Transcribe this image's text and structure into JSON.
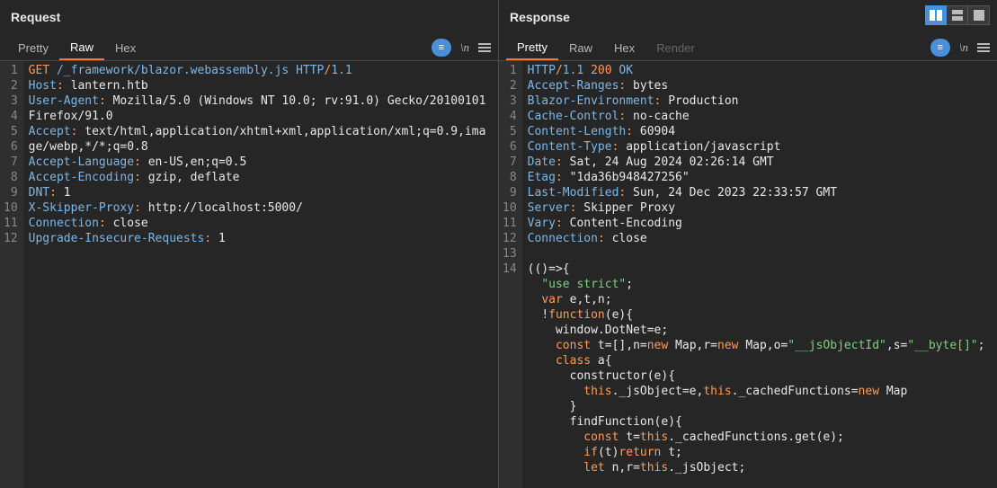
{
  "request": {
    "title": "Request",
    "tabs": {
      "pretty": "Pretty",
      "raw": "Raw",
      "hex": "Hex"
    },
    "lines": [
      {
        "n": "1",
        "seg": [
          [
            "m",
            "GET"
          ],
          [
            "w",
            " "
          ],
          [
            "hk",
            "/_framework/blazor.webassembly.js"
          ],
          [
            "w",
            " "
          ],
          [
            "hk",
            "HTTP"
          ],
          [
            "m",
            "/"
          ],
          [
            "hk",
            "1.1"
          ]
        ]
      },
      {
        "n": "2",
        "seg": [
          [
            "hk",
            "Host"
          ],
          [
            "m",
            ":"
          ],
          [
            "w",
            " lantern.htb"
          ]
        ]
      },
      {
        "n": "3",
        "seg": [
          [
            "hk",
            "User-Agent"
          ],
          [
            "m",
            ":"
          ],
          [
            "w",
            " Mozilla/5.0 (Windows NT 10.0; rv:91.0) Gecko/20100101 Firefox/91.0"
          ]
        ]
      },
      {
        "n": "4",
        "seg": [
          [
            "hk",
            "Accept"
          ],
          [
            "m",
            ":"
          ],
          [
            "w",
            " text/html,application/xhtml+xml,application/xml;q=0.9,image/webp,*/*;q=0.8"
          ]
        ]
      },
      {
        "n": "5",
        "seg": [
          [
            "hk",
            "Accept-Language"
          ],
          [
            "m",
            ":"
          ],
          [
            "w",
            " en-US,en;q=0.5"
          ]
        ]
      },
      {
        "n": "6",
        "seg": [
          [
            "hk",
            "Accept-Encoding"
          ],
          [
            "m",
            ":"
          ],
          [
            "w",
            " gzip, deflate"
          ]
        ]
      },
      {
        "n": "7",
        "seg": [
          [
            "hk",
            "DNT"
          ],
          [
            "m",
            ":"
          ],
          [
            "w",
            " 1"
          ]
        ]
      },
      {
        "n": "8",
        "seg": [
          [
            "hk",
            "X-Skipper-Proxy"
          ],
          [
            "m",
            ":"
          ],
          [
            "w",
            " http://localhost:5000/"
          ]
        ]
      },
      {
        "n": "9",
        "seg": [
          [
            "hk",
            "Connection"
          ],
          [
            "m",
            ":"
          ],
          [
            "w",
            " close"
          ]
        ]
      },
      {
        "n": "10",
        "seg": [
          [
            "hk",
            "Upgrade-Insecure-Requests"
          ],
          [
            "m",
            ":"
          ],
          [
            "w",
            " 1"
          ]
        ]
      },
      {
        "n": "11",
        "seg": []
      },
      {
        "n": "12",
        "seg": []
      }
    ]
  },
  "response": {
    "title": "Response",
    "tabs": {
      "pretty": "Pretty",
      "raw": "Raw",
      "hex": "Hex",
      "render": "Render"
    },
    "lines": [
      {
        "n": "1",
        "seg": [
          [
            "hk",
            "HTTP"
          ],
          [
            "m",
            "/"
          ],
          [
            "hk",
            "1.1 "
          ],
          [
            "m",
            "200 "
          ],
          [
            "hk",
            "OK"
          ]
        ]
      },
      {
        "n": "2",
        "seg": [
          [
            "hk",
            "Accept-Ranges"
          ],
          [
            "m",
            ":"
          ],
          [
            "w",
            " bytes"
          ]
        ]
      },
      {
        "n": "3",
        "seg": [
          [
            "hk",
            "Blazor-Environment"
          ],
          [
            "m",
            ":"
          ],
          [
            "w",
            " Production"
          ]
        ]
      },
      {
        "n": "4",
        "seg": [
          [
            "hk",
            "Cache-Control"
          ],
          [
            "m",
            ":"
          ],
          [
            "w",
            " no-cache"
          ]
        ]
      },
      {
        "n": "5",
        "seg": [
          [
            "hk",
            "Content-Length"
          ],
          [
            "m",
            ":"
          ],
          [
            "w",
            " 60904"
          ]
        ]
      },
      {
        "n": "6",
        "seg": [
          [
            "hk",
            "Content-Type"
          ],
          [
            "m",
            ":"
          ],
          [
            "w",
            " application/javascript"
          ]
        ]
      },
      {
        "n": "7",
        "seg": [
          [
            "hk",
            "Date"
          ],
          [
            "m",
            ":"
          ],
          [
            "w",
            " Sat, 24 Aug 2024 02:26:14 GMT"
          ]
        ]
      },
      {
        "n": "8",
        "seg": [
          [
            "hk",
            "Etag"
          ],
          [
            "m",
            ":"
          ],
          [
            "w",
            " \"1da36b948427256\""
          ]
        ]
      },
      {
        "n": "9",
        "seg": [
          [
            "hk",
            "Last-Modified"
          ],
          [
            "m",
            ":"
          ],
          [
            "w",
            " Sun, 24 Dec 2023 22:33:57 GMT"
          ]
        ]
      },
      {
        "n": "10",
        "seg": [
          [
            "hk",
            "Server"
          ],
          [
            "m",
            ":"
          ],
          [
            "w",
            " Skipper Proxy"
          ]
        ]
      },
      {
        "n": "11",
        "seg": [
          [
            "hk",
            "Vary"
          ],
          [
            "m",
            ":"
          ],
          [
            "w",
            " Content-Encoding"
          ]
        ]
      },
      {
        "n": "12",
        "seg": [
          [
            "hk",
            "Connection"
          ],
          [
            "m",
            ":"
          ],
          [
            "w",
            " close"
          ]
        ]
      },
      {
        "n": "13",
        "seg": []
      },
      {
        "n": "14",
        "seg": [
          [
            "w",
            "(()=>{"
          ]
        ]
      },
      {
        "n": "",
        "seg": [
          [
            "w",
            "  "
          ],
          [
            "s",
            "\"use strict\""
          ],
          [
            "w",
            ";"
          ]
        ]
      },
      {
        "n": "",
        "seg": [
          [
            "w",
            "  "
          ],
          [
            "kw",
            "var"
          ],
          [
            "w",
            " e,t,n;"
          ]
        ]
      },
      {
        "n": "",
        "seg": [
          [
            "w",
            "  !"
          ],
          [
            "kw",
            "function"
          ],
          [
            "w",
            "(e){"
          ]
        ]
      },
      {
        "n": "",
        "seg": [
          [
            "w",
            "    window.DotNet=e;"
          ]
        ]
      },
      {
        "n": "",
        "seg": [
          [
            "w",
            "    "
          ],
          [
            "kw",
            "const"
          ],
          [
            "w",
            " t=[],n="
          ],
          [
            "kw",
            "new"
          ],
          [
            "w",
            " Map,r="
          ],
          [
            "kw",
            "new"
          ],
          [
            "w",
            " Map,o="
          ],
          [
            "s",
            "\"__jsObjectId\""
          ],
          [
            "w",
            ",s="
          ],
          [
            "s",
            "\"__byte[]\""
          ],
          [
            "w",
            ";"
          ]
        ]
      },
      {
        "n": "",
        "seg": [
          [
            "w",
            "    "
          ],
          [
            "kw",
            "class"
          ],
          [
            "w",
            " a{"
          ]
        ]
      },
      {
        "n": "",
        "seg": [
          [
            "w",
            "      constructor(e){"
          ]
        ]
      },
      {
        "n": "",
        "seg": [
          [
            "w",
            "        "
          ],
          [
            "kw",
            "this"
          ],
          [
            "w",
            "._jsObject=e,"
          ],
          [
            "kw",
            "this"
          ],
          [
            "w",
            "._cachedFunctions="
          ],
          [
            "kw",
            "new"
          ],
          [
            "w",
            " Map"
          ]
        ]
      },
      {
        "n": "",
        "seg": [
          [
            "w",
            "      }"
          ]
        ]
      },
      {
        "n": "",
        "seg": [
          [
            "w",
            "      findFunction(e){"
          ]
        ]
      },
      {
        "n": "",
        "seg": [
          [
            "w",
            "        "
          ],
          [
            "kw",
            "const"
          ],
          [
            "w",
            " t="
          ],
          [
            "kw",
            "this"
          ],
          [
            "w",
            "._cachedFunctions.get(e);"
          ]
        ]
      },
      {
        "n": "",
        "seg": [
          [
            "w",
            "        "
          ],
          [
            "kw",
            "if"
          ],
          [
            "w",
            "(t)"
          ],
          [
            "kw",
            "return"
          ],
          [
            "w",
            " t;"
          ]
        ]
      },
      {
        "n": "",
        "seg": [
          [
            "w",
            "        "
          ],
          [
            "kw",
            "let"
          ],
          [
            "w",
            " n,r="
          ],
          [
            "kw",
            "this"
          ],
          [
            "w",
            "._jsObject;"
          ]
        ]
      }
    ]
  },
  "chip": "≡"
}
